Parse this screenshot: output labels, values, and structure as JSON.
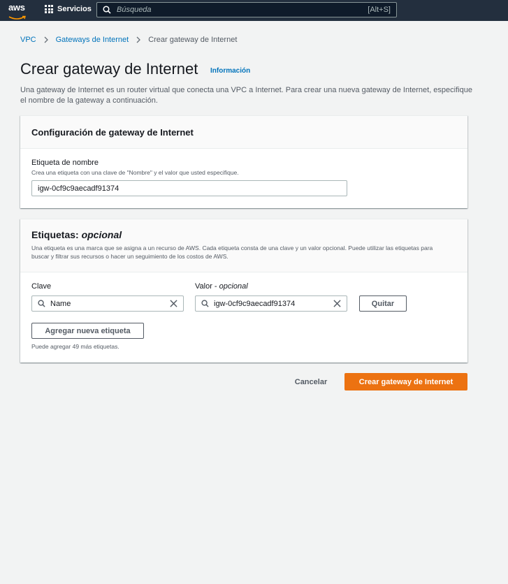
{
  "topnav": {
    "logo_text": "aws",
    "services_label": "Servicios",
    "search_placeholder": "Búsqueda",
    "search_shortcut": "[Alt+S]"
  },
  "breadcrumb": {
    "items": [
      "VPC",
      "Gateways de Internet"
    ],
    "current": "Crear gateway de Internet"
  },
  "header": {
    "title": "Crear gateway de Internet",
    "info_link": "Información",
    "description": "Una gateway de Internet es un router virtual que conecta una VPC a Internet. Para crear una nueva gateway de Internet, especifique el nombre de la gateway a continuación."
  },
  "config_panel": {
    "title": "Configuración de gateway de Internet",
    "name_label": "Etiqueta de nombre",
    "name_description": "Crea una etiqueta con una clave de \"Nombre\" y el valor que usted especifique.",
    "name_value": "igw-0cf9c9aecadf91374"
  },
  "tags_panel": {
    "title": "Etiquetas:",
    "title_suffix": "opcional",
    "description": "Una etiqueta es una marca que se asigna a un recurso de AWS. Cada etiqueta consta de una clave y un valor opcional. Puede utilizar las etiquetas para buscar y filtrar sus recursos o hacer un seguimiento de los costos de AWS.",
    "key_label": "Clave",
    "value_label": "Valor -",
    "value_label_suffix": "opcional",
    "key_value": "Name",
    "value_value": "igw-0cf9c9aecadf91374",
    "remove_button": "Quitar",
    "add_button": "Agregar nueva etiqueta",
    "limit_note": "Puede agregar 49 más etiquetas."
  },
  "actions": {
    "cancel": "Cancelar",
    "submit": "Crear gateway de Internet"
  },
  "colors": {
    "nav_bg": "#232f3e",
    "link": "#0073bb",
    "primary": "#ec7211",
    "aws_smile": "#ff9900"
  }
}
